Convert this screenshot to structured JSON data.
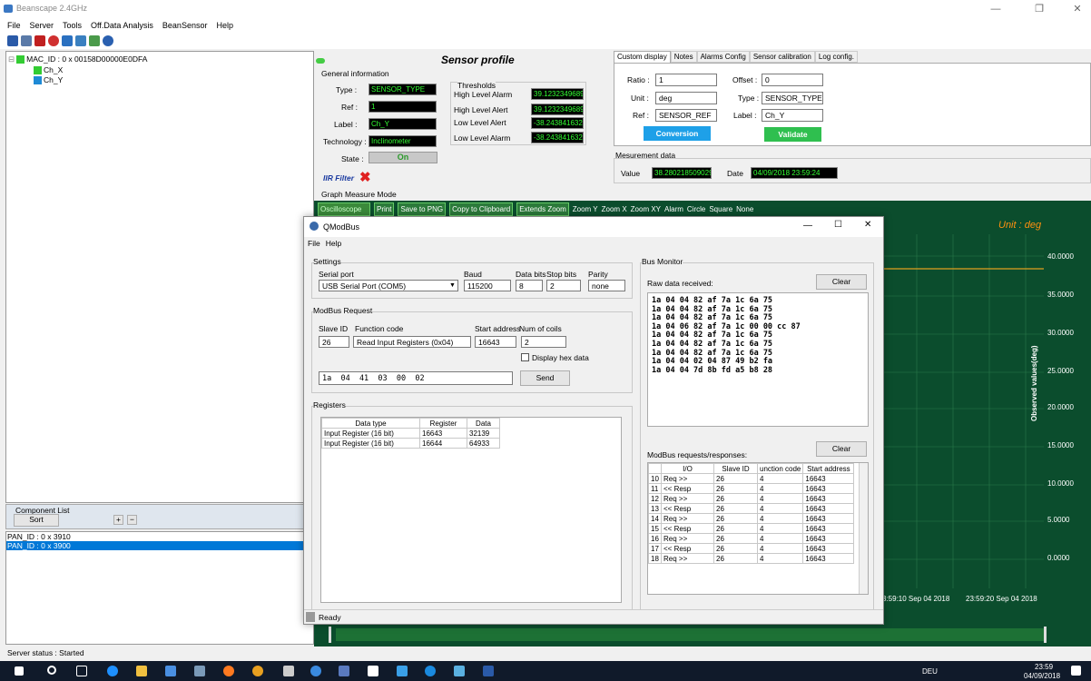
{
  "app": {
    "title": "Beanscape 2.4GHz"
  },
  "menu": [
    "File",
    "Server",
    "Tools",
    "Off.Data Analysis",
    "BeanSensor",
    "Help"
  ],
  "tree": {
    "root": "MAC_ID : 0 x 00158D00000E0DFA",
    "children": [
      "Ch_X",
      "Ch_Y"
    ]
  },
  "component_list": {
    "title": "Component List",
    "sort": "Sort",
    "plus": "+",
    "minus": "−"
  },
  "pan_list": [
    "PAN_ID : 0 x 3910",
    "PAN_ID : 0 x 3900"
  ],
  "status": "Server status : Started",
  "sensor_profile": {
    "title": "Sensor profile",
    "general_info": "General information",
    "type_label": "Type :",
    "type_value": "SENSOR_TYPE",
    "ref_label": "Ref :",
    "ref_value": "1",
    "label_label": "Label :",
    "label_value": "Ch_Y",
    "tech_label": "Technology :",
    "tech_value": "Inclinometer",
    "state_label": "State :",
    "state_value": "On",
    "iir": "IIR Filter",
    "thresholds": "Thresholds",
    "thr": [
      {
        "label": "High Level Alarm",
        "value": "39.1232349689"
      },
      {
        "label": "High Level Alert",
        "value": "39.1232349689"
      },
      {
        "label": "Low Level Alert",
        "value": "-38.2438416320"
      },
      {
        "label": "Low Level Alarm",
        "value": "-38.2438416320"
      }
    ],
    "graph_mode": "Graph Measure Mode"
  },
  "tabs": [
    "Custom display",
    "Notes",
    "Alarms Config",
    "Sensor calibration",
    "Log config."
  ],
  "custom": {
    "ratio_label": "Ratio :",
    "ratio": "1",
    "offset_label": "Offset :",
    "offset": "0",
    "unit_label": "Unit :",
    "unit": "deg",
    "ctype_label": "Type :",
    "ctype": "SENSOR_TYPE",
    "cref_label": "Ref :",
    "cref": "SENSOR_REF",
    "clabel_label": "Label :",
    "clabel": "Ch_Y",
    "conversion": "Conversion",
    "validate": "Validate",
    "measurement": "Mesurement data",
    "value_label": "Value",
    "value": "38.280218509029",
    "date_label": "Date",
    "date": "04/09/2018 23:59:24"
  },
  "graph_toolbar": {
    "mode": "Oscilloscope",
    "print": "Print",
    "save": "Save to PNG",
    "copy": "Copy to Clipboard",
    "extend": "Extends Zoom",
    "zoomy": "Zoom Y",
    "zoomx": "Zoom X",
    "zoomxy": "Zoom XY",
    "alarm": "Alarm",
    "circle": "Circle",
    "square": "Square",
    "none": "None"
  },
  "graph": {
    "unit": "Unit : deg",
    "ylabel": "Observed values(deg)",
    "yticks": [
      "40.0000",
      "35.0000",
      "30.0000",
      "25.0000",
      "20.0000",
      "15.0000",
      "10.0000",
      "5.0000",
      "0.0000"
    ],
    "xticks": [
      "3:59:10 Sep 04 2018",
      "23:59:20 Sep 04 2018"
    ]
  },
  "qmodbus": {
    "title": "QModBus",
    "menu": [
      "File",
      "Help"
    ],
    "settings": "Settings",
    "serial_label": "Serial port",
    "serial": "USB Serial Port (COM5)",
    "baud_label": "Baud",
    "baud": "115200",
    "databits_label": "Data bits",
    "databits": "8",
    "stopbits_label": "Stop bits",
    "stopbits": "2",
    "parity_label": "Parity",
    "parity": "none",
    "request": "ModBus Request",
    "slave_label": "Slave ID",
    "slave": "26",
    "func_label": "Function code",
    "func": "Read Input Registers (0x04)",
    "start_label": "Start address",
    "start": "16643",
    "coils_label": "Num of coils",
    "coils": "2",
    "hex_label": "Display hex data",
    "raw": "1a  04  41  03  00  02",
    "send": "Send",
    "registers": "Registers",
    "reg_headers": [
      "Data type",
      "Register",
      "Data"
    ],
    "reg_rows": [
      [
        "Input Register (16 bit)",
        "16643",
        "32139"
      ],
      [
        "Input Register (16 bit)",
        "16644",
        "64933"
      ]
    ],
    "bus_monitor": "Bus Monitor",
    "raw_received": "Raw data received:",
    "clear": "Clear",
    "raw_lines": "1a 04 04 82 af 7a 1c 6a 75\n1a 04 04 82 af 7a 1c 6a 75\n1a 04 04 82 af 7a 1c 6a 75\n1a 04 06 82 af 7a 1c 00 00 cc 87\n1a 04 04 82 af 7a 1c 6a 75\n1a 04 04 82 af 7a 1c 6a 75\n1a 04 04 82 af 7a 1c 6a 75\n1a 04 04 02 04 87 49 b2 fa\n1a 04 04 7d 8b fd a5 b8 28",
    "reqresp": "ModBus requests/responses:",
    "rr_headers": [
      "I/O",
      "Slave ID",
      "unction code",
      "Start address"
    ],
    "rr_rows": [
      [
        "10",
        "Req >>",
        "26",
        "4",
        "16643"
      ],
      [
        "11",
        "<< Resp",
        "26",
        "4",
        "16643"
      ],
      [
        "12",
        "Req >>",
        "26",
        "4",
        "16643"
      ],
      [
        "13",
        "<< Resp",
        "26",
        "4",
        "16643"
      ],
      [
        "14",
        "Req >>",
        "26",
        "4",
        "16643"
      ],
      [
        "15",
        "<< Resp",
        "26",
        "4",
        "16643"
      ],
      [
        "16",
        "Req >>",
        "26",
        "4",
        "16643"
      ],
      [
        "17",
        "<< Resp",
        "26",
        "4",
        "16643"
      ],
      [
        "18",
        "Req >>",
        "26",
        "4",
        "16643"
      ]
    ],
    "status": "Ready"
  },
  "taskbar": {
    "lang": "DEU",
    "time": "23:59",
    "date": "04/09/2018"
  }
}
